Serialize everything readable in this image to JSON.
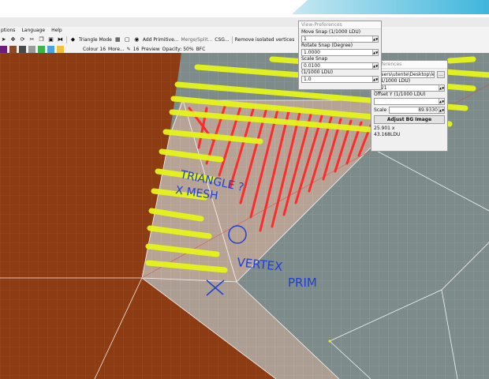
{
  "menubar": [
    "ptions",
    "Language",
    "Help"
  ],
  "toolbar1": {
    "triangle_mode": "Triangle Mode",
    "add_primitive": "Add Primitive...",
    "merge_split": "Merge/Split...",
    "csg": "CSG...",
    "remove_isolated": "Remove isolated vertices"
  },
  "toolbar2": {
    "colour": "Colour 16",
    "more": "More...",
    "line_count": "16",
    "preview": "Preview",
    "opacity": "Opacity: 50%",
    "bfc": "BFC"
  },
  "swatches": [
    "#6b1f7a",
    "#8b4a2b",
    "#4a4a4a",
    "#9a9a9a",
    "#39b54a",
    "#4aa3df",
    "#f3c23c"
  ],
  "view_prefs": {
    "title": "View-Preferences",
    "move_snap_label": "Move Snap (1/1000 LDU)",
    "move_snap_value": "1",
    "rotate_snap_label": "Rotate Snap (Degree)",
    "rotate_snap_value": "1.0000",
    "scale_snap_label": "Scale Snap",
    "scale_snap_value": "0.0100",
    "extra_label": "(1/1000 LDU)",
    "extra_value": "1.0"
  },
  "bg_prefs": {
    "title": "Preferences",
    "path": "\\Users\\utente\\Desktop\\lettere\\S",
    "offset_x_label": "X (1/1000 LDU)",
    "offset_x_value": "-521",
    "offset_y_label": "Offset Y (1/1000 LDU)",
    "scale_label": "Scale",
    "scale_value": "89.9330",
    "adjust_button": "Adjust BG Image",
    "size_line1": "25.901 x",
    "size_line2": "43.168LDU"
  },
  "annotations": {
    "triangle_mesh_line1": "TRIANGLE ?",
    "triangle_mesh_line2": "X MESH",
    "vertex_line1": "VERTEX",
    "vertex_line2": "PRIM",
    "x_mark": "X"
  },
  "colors": {
    "highlight_yellow": "#e6f51a",
    "hatch_red": "#ff2a2a",
    "ink_blue": "#1f3fd6",
    "brown_surface": "#8a3a12",
    "grey_mesh": "#7f8a8a"
  }
}
